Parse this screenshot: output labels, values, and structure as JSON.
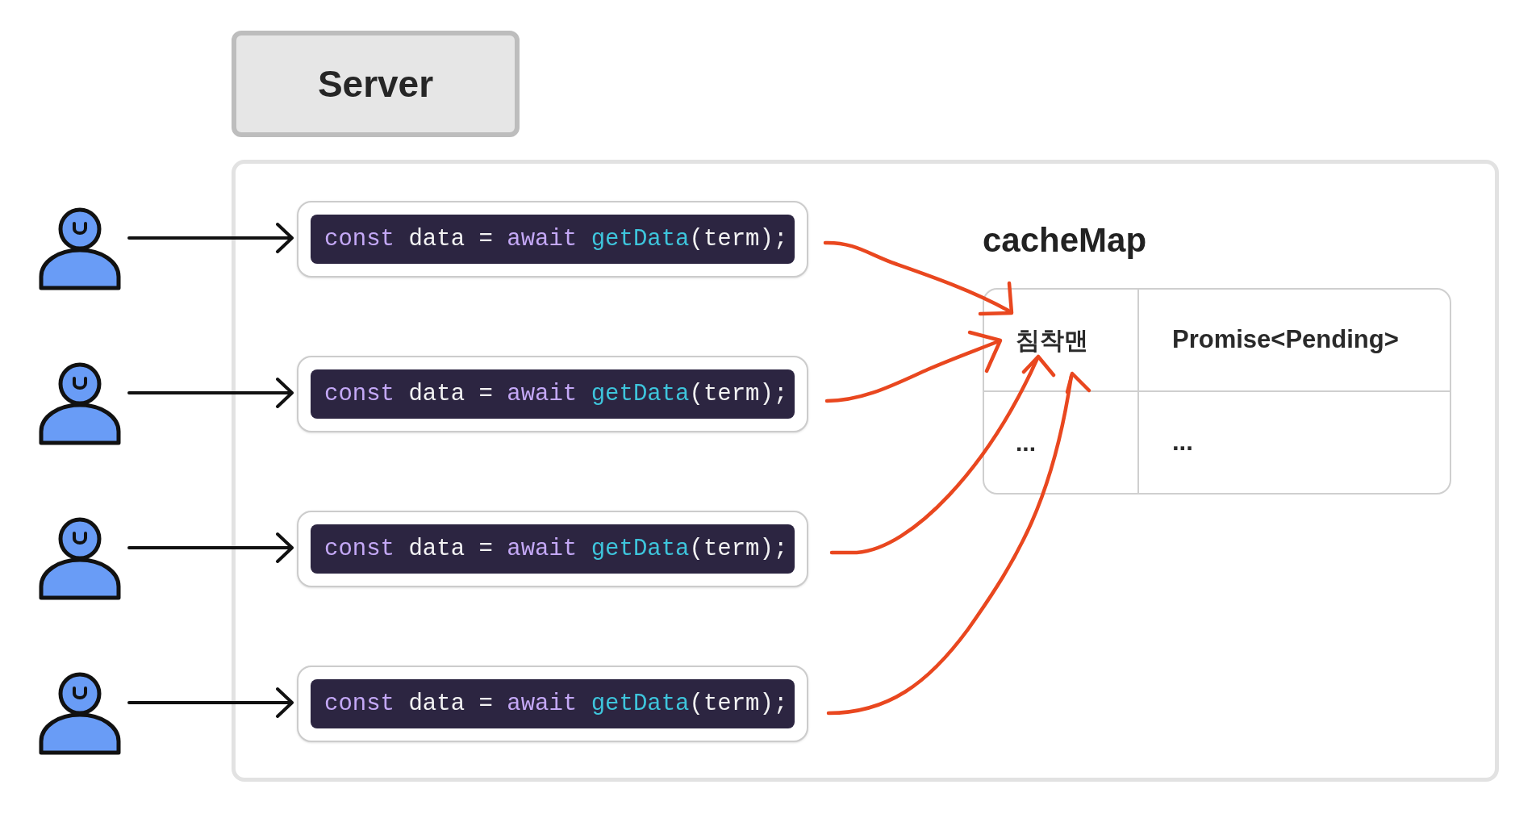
{
  "server": {
    "title": "Server"
  },
  "requests": [
    {
      "code": [
        {
          "text": "const",
          "kind": "keyword"
        },
        {
          "text": " data = ",
          "kind": "plain"
        },
        {
          "text": "await ",
          "kind": "keyword"
        },
        {
          "text": "getData",
          "kind": "function"
        },
        {
          "text": "(term);",
          "kind": "plain"
        }
      ]
    },
    {
      "code": [
        {
          "text": "const",
          "kind": "keyword"
        },
        {
          "text": " data = ",
          "kind": "plain"
        },
        {
          "text": "await ",
          "kind": "keyword"
        },
        {
          "text": "getData",
          "kind": "function"
        },
        {
          "text": "(term);",
          "kind": "plain"
        }
      ]
    },
    {
      "code": [
        {
          "text": "const",
          "kind": "keyword"
        },
        {
          "text": " data = ",
          "kind": "plain"
        },
        {
          "text": "await ",
          "kind": "keyword"
        },
        {
          "text": "getData",
          "kind": "function"
        },
        {
          "text": "(term);",
          "kind": "plain"
        }
      ]
    },
    {
      "code": [
        {
          "text": "const",
          "kind": "keyword"
        },
        {
          "text": " data = ",
          "kind": "plain"
        },
        {
          "text": "await ",
          "kind": "keyword"
        },
        {
          "text": "getData",
          "kind": "function"
        },
        {
          "text": "(term);",
          "kind": "plain"
        }
      ]
    }
  ],
  "cache_map": {
    "title": "cacheMap",
    "rows": [
      {
        "key": "침착맨",
        "value": "Promise<Pending>"
      },
      {
        "key": "...",
        "value": "..."
      }
    ]
  }
}
